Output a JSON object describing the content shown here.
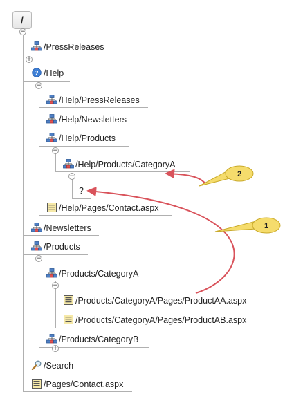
{
  "root": {
    "label": "/"
  },
  "nodes": {
    "press_releases": "/PressReleases",
    "help": "/Help",
    "help_press_releases": "/Help/PressReleases",
    "help_newsletters": "/Help/Newsletters",
    "help_products": "/Help/Products",
    "help_products_category_a": "/Help/Products/CategoryA",
    "unknown": "?",
    "help_contact": "/Help/Pages/Contact.aspx",
    "newsletters": "/Newsletters",
    "products": "/Products",
    "products_category_a": "/Products/CategoryA",
    "product_aa": "/Products/CategoryA/Pages/ProductAA.aspx",
    "product_ab": "/Products/CategoryA/Pages/ProductAB.aspx",
    "products_category_b": "/Products/CategoryB",
    "search": "/Search",
    "contact": "/Pages/Contact.aspx"
  },
  "toggles": {
    "expanded": "−",
    "collapsed": "+"
  },
  "callouts": {
    "first": "1",
    "second": "2"
  },
  "colors": {
    "arrow": "#d9535b",
    "callout_fill": "#f5dc6c",
    "line": "#b0b0b0"
  },
  "icons": {
    "site": "sitemap-icon",
    "help": "help-icon",
    "page": "page-icon",
    "search": "search-icon"
  }
}
